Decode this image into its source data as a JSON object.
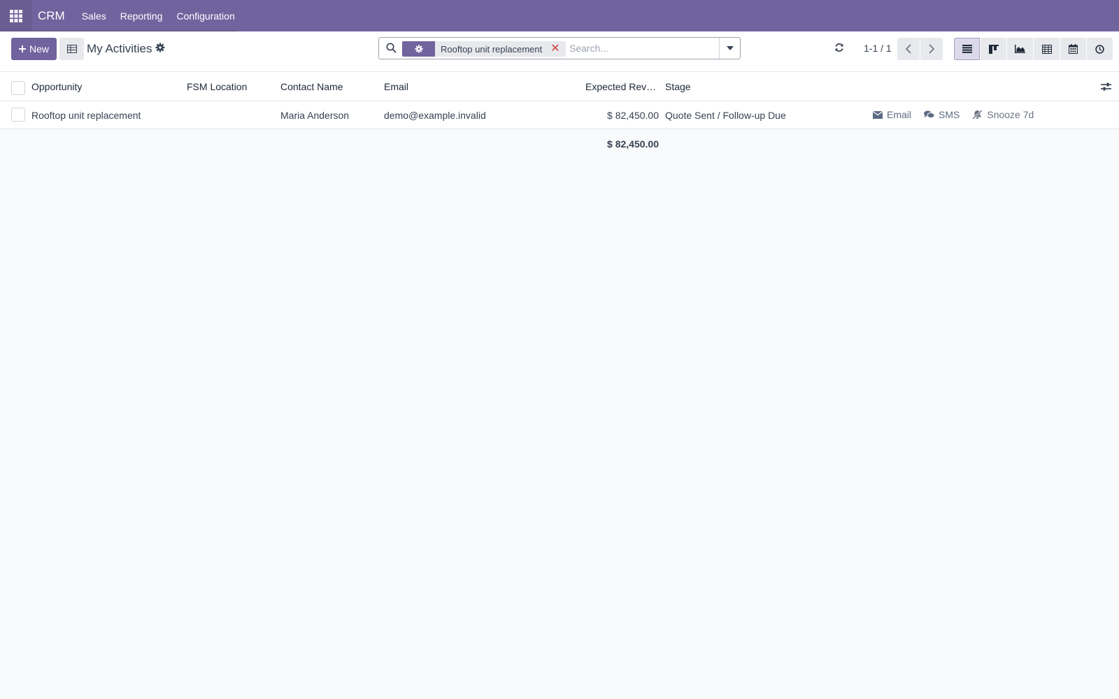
{
  "navbar": {
    "brand": "CRM",
    "menu": [
      "Sales",
      "Reporting",
      "Configuration"
    ]
  },
  "control_panel": {
    "new_label": "New",
    "title": "My Activities",
    "search": {
      "facet_value": "Rooftop unit replacement",
      "placeholder": "Search..."
    },
    "pager": "1-1 / 1",
    "views": [
      "list-icon",
      "kanban-icon",
      "graph-icon",
      "pivot-icon",
      "calendar-icon",
      "activity-icon"
    ]
  },
  "table": {
    "columns": [
      "Opportunity",
      "FSM Location",
      "Contact Name",
      "Email",
      "Expected Rev…",
      "Stage"
    ],
    "rows": [
      {
        "opportunity": "Rooftop unit replacement",
        "fsm_location": "",
        "contact_name": "Maria Anderson",
        "email": "demo@example.invalid",
        "expected_revenue": "$ 82,450.00",
        "stage": "Quote Sent / Follow-up Due",
        "actions": [
          "Email",
          "SMS",
          "Snooze 7d"
        ]
      }
    ],
    "total": "$ 82,450.00"
  },
  "colors": {
    "brand": "#71639e",
    "background": "#f9fafb",
    "remove": "#d23f3a"
  }
}
